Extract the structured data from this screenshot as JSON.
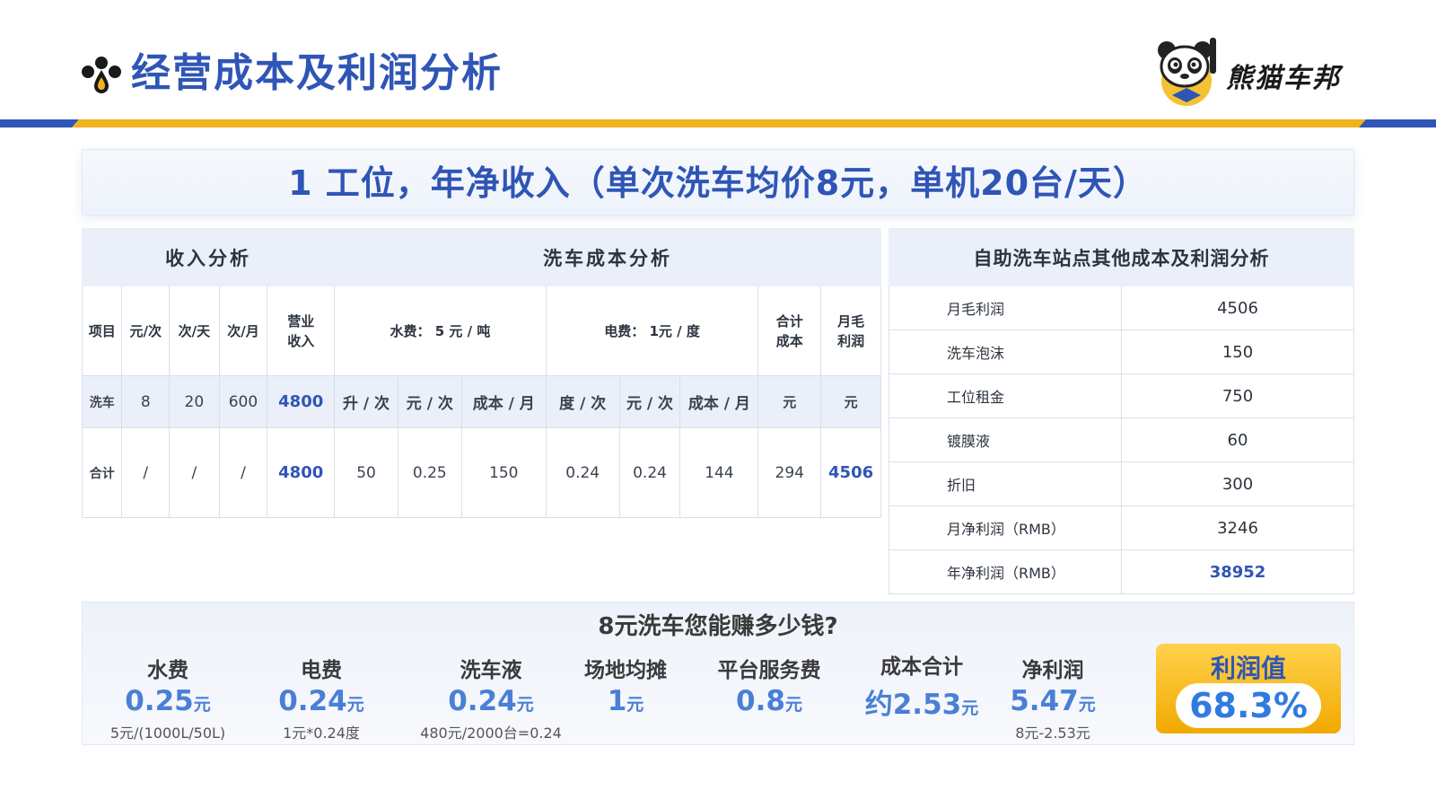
{
  "header": {
    "title": "经营成本及利润分析",
    "brand_name": "熊猫车邦",
    "colors": {
      "primary": "#2f55b6",
      "accent": "#f2b21b"
    }
  },
  "banner": {
    "text": "1 工位，年净收入（单次洗车均价8元，单机20台/天）"
  },
  "left_table": {
    "income_section": "收入分析",
    "cost_section": "洗车成本分析",
    "headers": {
      "item": "项目",
      "price": "元/次",
      "per_day": "次/天",
      "per_month": "次/月",
      "revenue": "营业收入",
      "water": "水费： 5 元 / 吨",
      "power": "电费： 1元 / 度",
      "total_cost": "合计成本",
      "gross_profit": "月毛利润"
    },
    "subheaders": {
      "liters": "升 / 次",
      "water_price": "元 / 次",
      "water_monthly": "成本 / 月",
      "kwh": "度 / 次",
      "power_price": "元 / 次",
      "power_monthly": "成本 / 月",
      "total_unit": "元",
      "gross_unit": "元"
    },
    "wash_row": {
      "label": "洗车",
      "price": "8",
      "per_day": "20",
      "per_month": "600",
      "revenue": "4800"
    },
    "total_row": {
      "label": "合计",
      "price": "/",
      "per_day": "/",
      "per_month": "/",
      "revenue": "4800",
      "liters": "50",
      "water_price": "0.25",
      "water_monthly": "150",
      "kwh": "0.24",
      "power_price": "0.24",
      "power_monthly": "144",
      "total_cost": "294",
      "gross_profit": "4506"
    }
  },
  "right_table": {
    "title": "自助洗车站点其他成本及利润分析",
    "rows": [
      {
        "label": "月毛利润",
        "value": "4506"
      },
      {
        "label": "洗车泡沫",
        "value": "150"
      },
      {
        "label": "工位租金",
        "value": "750"
      },
      {
        "label": "镀膜液",
        "value": "60"
      },
      {
        "label": "折旧",
        "value": "300"
      },
      {
        "label": "月净利润（RMB）",
        "value": "3246"
      },
      {
        "label": "年净利润（RMB）",
        "value": "38952"
      }
    ]
  },
  "summary": {
    "title": "8元洗车您能赚多少钱?",
    "items": [
      {
        "name": "水费",
        "value": "0.25",
        "unit": "元",
        "note": "5元/(1000L/50L)"
      },
      {
        "name": "电费",
        "value": "0.24",
        "unit": "元",
        "note": "1元*0.24度"
      },
      {
        "name": "洗车液",
        "value": "0.24",
        "unit": "元",
        "note": "480元/2000台=0.24"
      },
      {
        "name": "场地均摊",
        "value": "1",
        "unit": "元",
        "note": ""
      },
      {
        "name": "平台服务费",
        "value": "0.8",
        "unit": "元",
        "note": ""
      },
      {
        "name": "成本合计",
        "value": "约2.53",
        "unit": "元",
        "note": ""
      },
      {
        "name": "净利润",
        "value": "5.47",
        "unit": "元",
        "note": "8元-2.53元"
      }
    ],
    "profit_label": "利润值",
    "profit_value": "68.3%"
  }
}
